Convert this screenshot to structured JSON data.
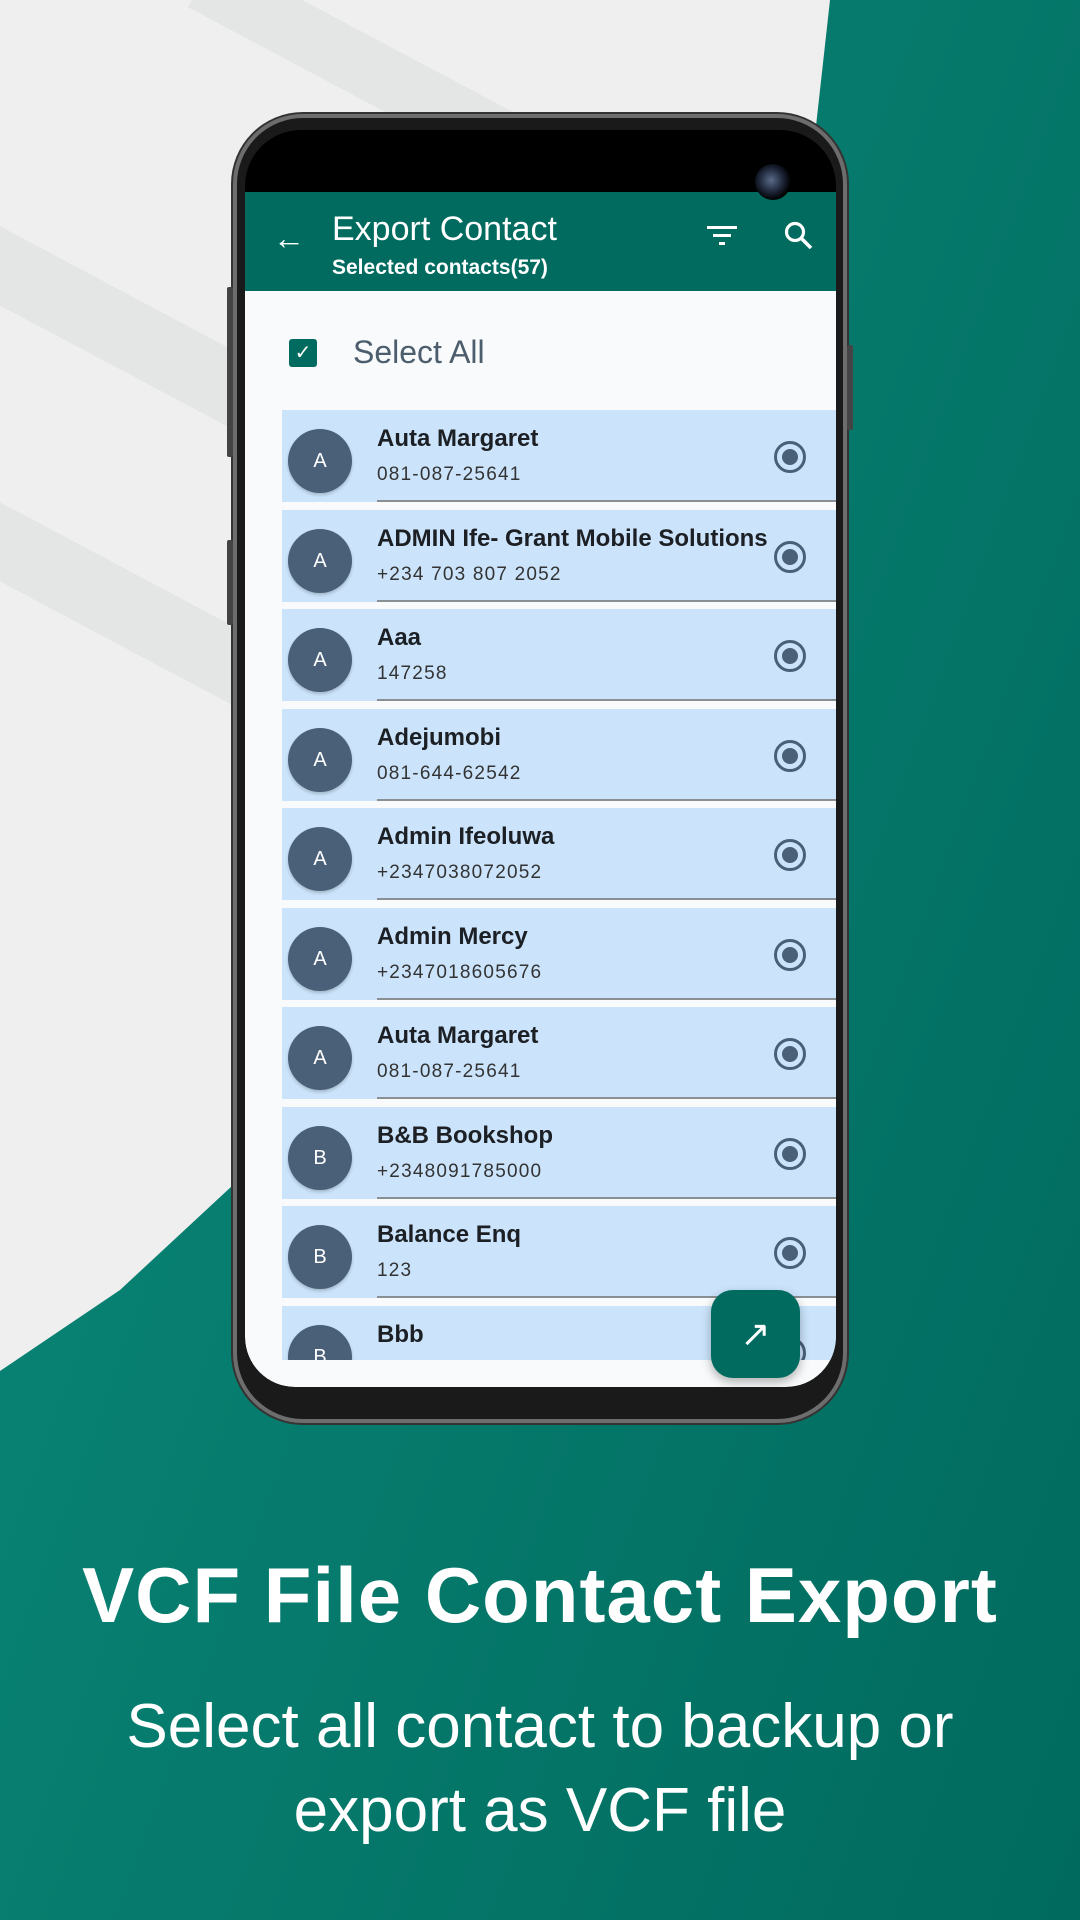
{
  "colors": {
    "brand": "#006b5e",
    "row_bg": "#cbe4fb",
    "avatar": "#4a6078"
  },
  "app": {
    "title": "Export Contact",
    "subtitle": "Selected contacts(57)",
    "icons": {
      "back": "arrow-left-icon",
      "filter": "filter-icon",
      "search": "search-icon",
      "fab": "export-arrow-icon"
    },
    "select_all": {
      "label": "Select All",
      "checked": true
    },
    "contacts": [
      {
        "initial": "A",
        "name": "Auta Margaret",
        "phone": "081-087-25641",
        "selected": true
      },
      {
        "initial": "A",
        "name": "ADMIN Ife- Grant Mobile Solutions",
        "phone": "+234 703 807 2052",
        "selected": true
      },
      {
        "initial": "A",
        "name": "Aaa",
        "phone": "147258",
        "selected": true
      },
      {
        "initial": "A",
        "name": "Adejumobi",
        "phone": "081-644-62542",
        "selected": true
      },
      {
        "initial": "A",
        "name": "Admin Ifeoluwa",
        "phone": "+2347038072052",
        "selected": true
      },
      {
        "initial": "A",
        "name": "Admin Mercy",
        "phone": "+2347018605676",
        "selected": true
      },
      {
        "initial": "A",
        "name": "Auta Margaret",
        "phone": "081-087-25641",
        "selected": true
      },
      {
        "initial": "B",
        "name": "B&B Bookshop",
        "phone": "+2348091785000",
        "selected": true
      },
      {
        "initial": "B",
        "name": "Balance Enq",
        "phone": "123",
        "selected": true
      },
      {
        "initial": "B",
        "name": "Bbb",
        "phone": "",
        "selected": true
      }
    ]
  },
  "promo": {
    "headline": "VCF File Contact Export",
    "line1": "Select all contact to backup or",
    "line2": "export as VCF file"
  }
}
